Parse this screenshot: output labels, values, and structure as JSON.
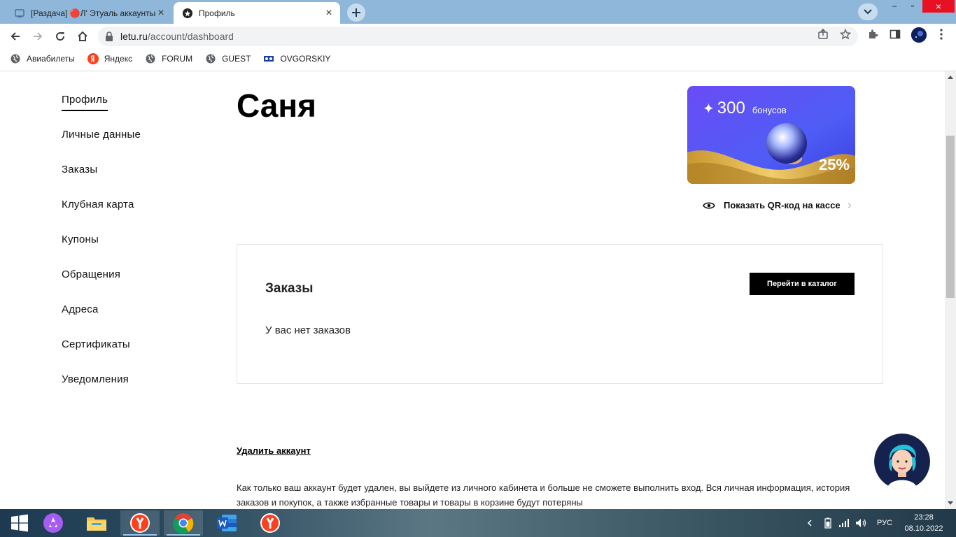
{
  "browser": {
    "tabs": [
      {
        "title": "[Раздача] 🔴Л' Этуаль аккаунты",
        "active": false
      },
      {
        "title": "Профиль",
        "active": true
      }
    ],
    "url_host": "letu.ru",
    "url_path": "/account/dashboard",
    "bookmarks": [
      "Авиабилеты",
      "Яндекс",
      "FORUM",
      "GUEST",
      "OVGORSKIY"
    ]
  },
  "sidebar": {
    "items": [
      {
        "label": "Профиль"
      },
      {
        "label": "Личные данные"
      },
      {
        "label": "Заказы"
      },
      {
        "label": "Клубная карта"
      },
      {
        "label": "Купоны"
      },
      {
        "label": "Обращения"
      },
      {
        "label": "Адреса"
      },
      {
        "label": "Сертификаты"
      },
      {
        "label": "Уведомления"
      }
    ]
  },
  "profile": {
    "name": "Саня"
  },
  "card": {
    "star": "✦",
    "bonus_value": "300",
    "bonus_label": "бонусов",
    "discount": "25%"
  },
  "qr": {
    "label": "Показать QR-код на кассе"
  },
  "orders": {
    "title": "Заказы",
    "catalog_button": "Перейти в каталог",
    "empty_text": "У вас нет заказов"
  },
  "account": {
    "delete_link": "Удалить аккаунт",
    "delete_notice": "Как только ваш аккаунт будет удален, вы выйдете из личного кабинета и больше не сможете выполнить вход. Вся личная информация, история заказов и покупок, а также избранные товары и товары в корзине будут потеряны"
  },
  "taskbar": {
    "language": "РУС",
    "time": "23:28",
    "date": "08.10.2022"
  },
  "colors": {
    "brand_black": "#000000",
    "card_purple": "#5a4ff5",
    "card_gold": "#d4a437"
  }
}
